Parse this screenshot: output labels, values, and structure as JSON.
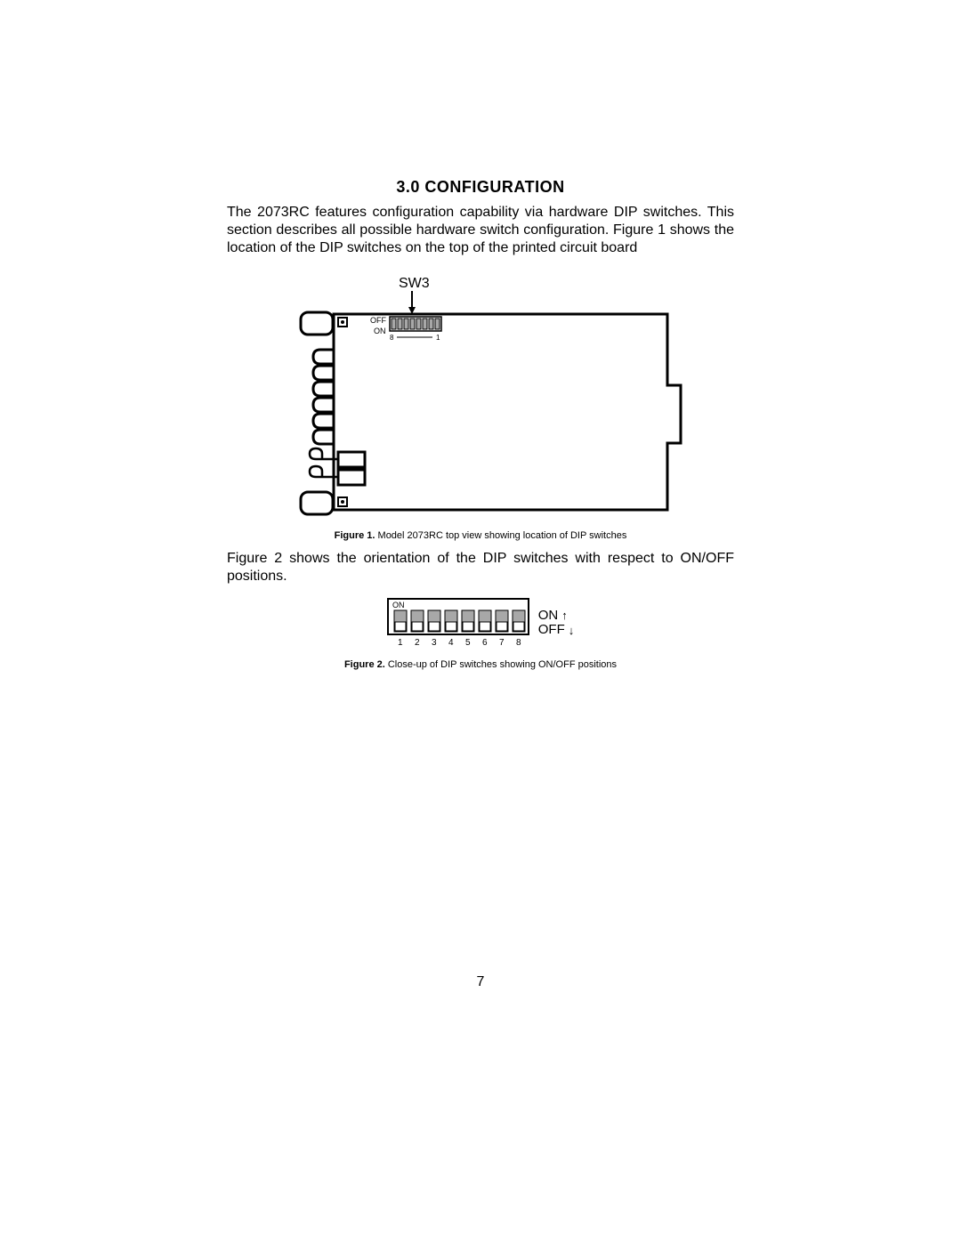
{
  "section": {
    "title": "3.0  CONFIGURATION",
    "intro": "The 2073RC features configuration capability via hardware DIP switches. This section describes all possible hardware switch configuration. Figure 1 shows the location of the DIP switches on the top of the printed circuit board",
    "fig1": {
      "sw3": "SW3",
      "off": "OFF",
      "on": "ON",
      "n8": "8",
      "n1": "1",
      "caption_bold": "Figure 1.",
      "caption_rest": " Model 2073RC top view showing location of DIP switches"
    },
    "between": "Figure 2 shows the orientation of the DIP switches with respect to ON/OFF positions.",
    "fig2": {
      "on_inside": "ON",
      "nums": [
        "1",
        "2",
        "3",
        "4",
        "5",
        "6",
        "7",
        "8"
      ],
      "on": "ON",
      "off": "OFF",
      "caption_bold": "Figure 2.",
      "caption_rest": " Close-up of DIP switches showing ON/OFF positions"
    }
  },
  "page_number": "7"
}
